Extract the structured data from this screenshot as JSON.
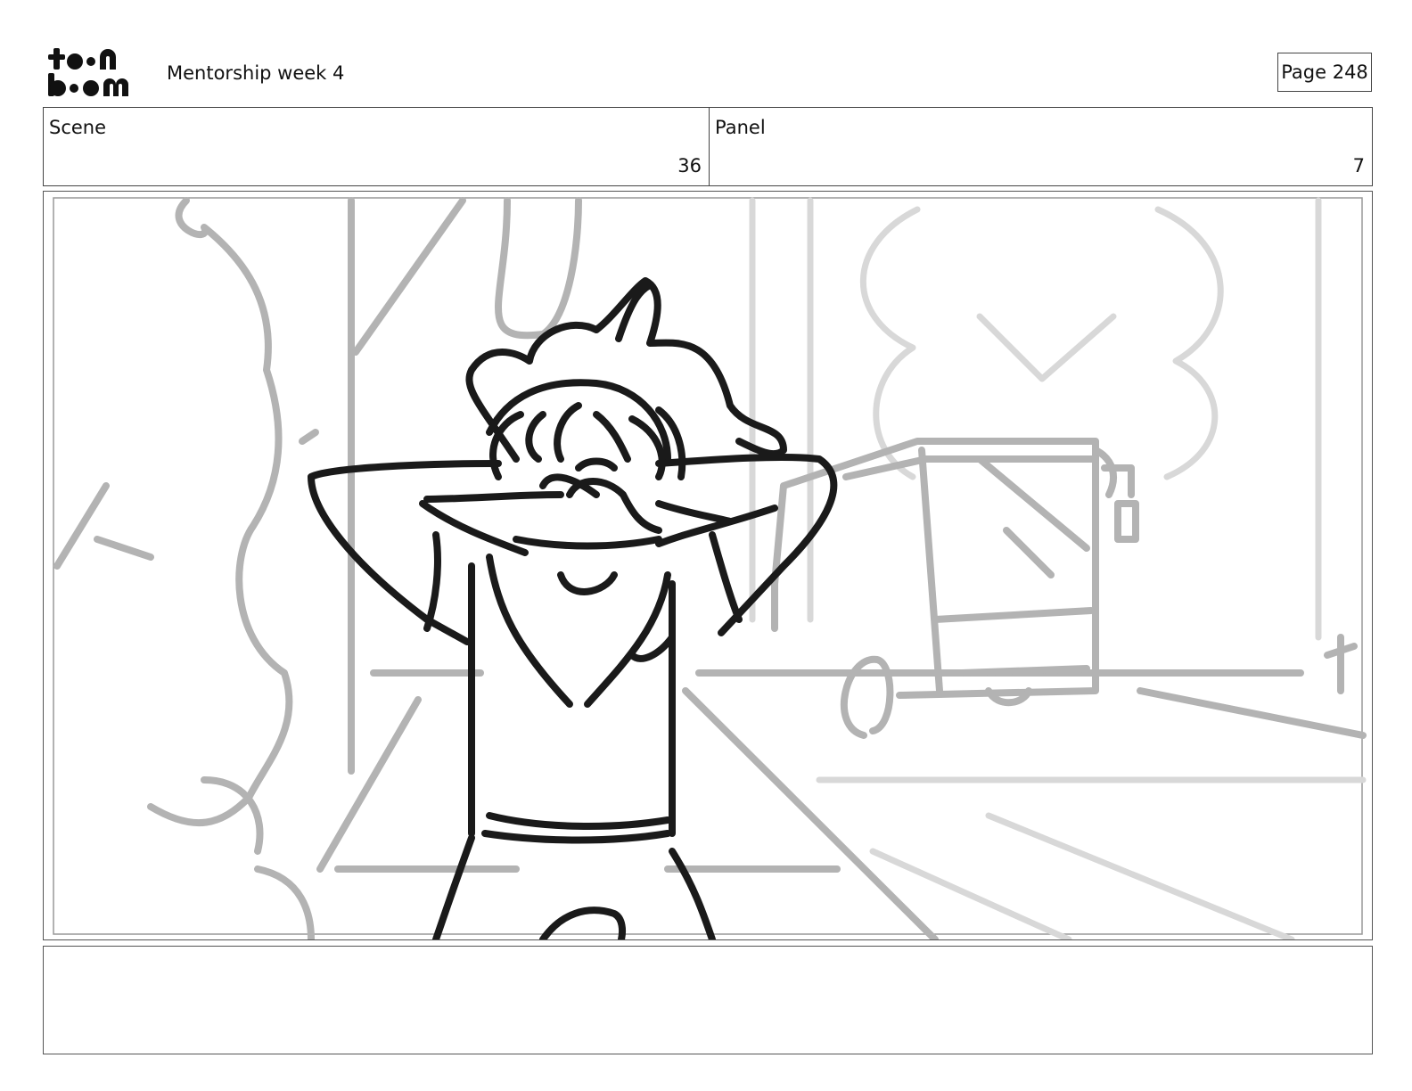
{
  "header": {
    "logo_name": "toon-boom-logo",
    "title": "Mentorship week 4",
    "page_label": "Page 248"
  },
  "info": {
    "scene_label": "Scene",
    "scene_value": "36",
    "panel_label": "Panel",
    "panel_value": "7"
  },
  "notes": {
    "text": ""
  },
  "colors": {
    "ink": "#1a1a1a",
    "sketch_gray": "#b0b0b0",
    "sketch_light": "#d6d6d6",
    "border": "#444444"
  }
}
